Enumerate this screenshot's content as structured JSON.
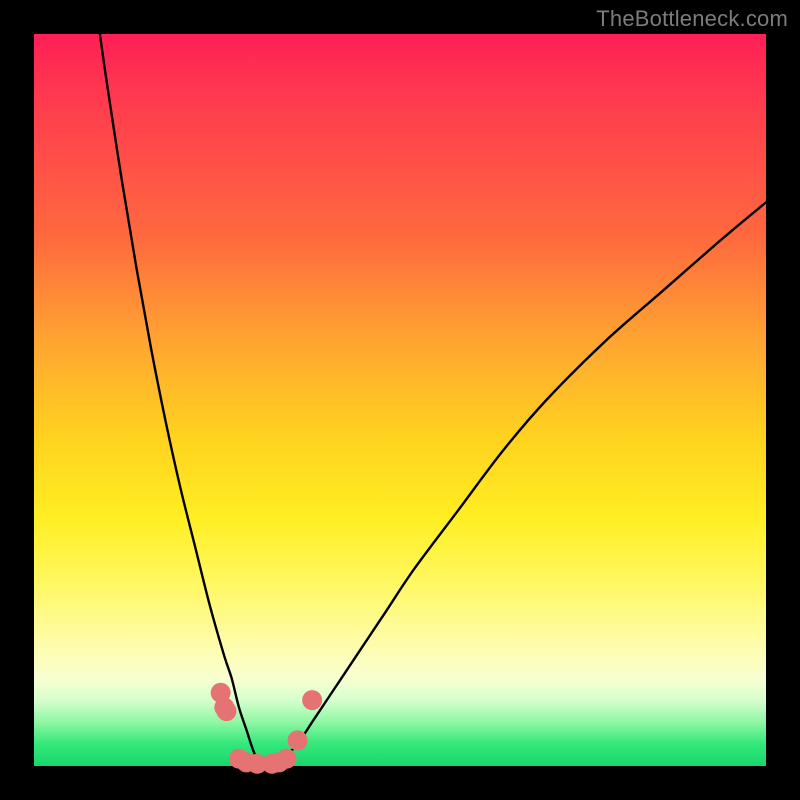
{
  "watermark": "TheBottleneck.com",
  "chart_data": {
    "type": "line",
    "title": "",
    "xlabel": "",
    "ylabel": "",
    "xlim": [
      0,
      100
    ],
    "ylim": [
      0,
      100
    ],
    "grid": false,
    "series": [
      {
        "name": "bottleneck-curve",
        "x": [
          9,
          10,
          12,
          14,
          16,
          18,
          20,
          22,
          24,
          26,
          27,
          28,
          29,
          30,
          31,
          32,
          33,
          34,
          36,
          38,
          40,
          44,
          48,
          52,
          58,
          64,
          70,
          78,
          86,
          94,
          100
        ],
        "values": [
          100,
          93,
          80,
          68,
          57,
          47,
          38,
          30,
          22,
          15,
          12,
          8,
          5,
          2,
          0,
          0,
          0,
          1,
          3,
          6,
          9,
          15,
          21,
          27,
          35,
          43,
          50,
          58,
          65,
          72,
          77
        ]
      }
    ],
    "markers": {
      "name": "highlight-dots",
      "color": "#e57373",
      "points": [
        {
          "x": 25.5,
          "y": 10
        },
        {
          "x": 26.0,
          "y": 8
        },
        {
          "x": 26.3,
          "y": 7.5
        },
        {
          "x": 28.0,
          "y": 1
        },
        {
          "x": 29.0,
          "y": 0.5
        },
        {
          "x": 30.5,
          "y": 0.3
        },
        {
          "x": 32.5,
          "y": 0.3
        },
        {
          "x": 33.5,
          "y": 0.5
        },
        {
          "x": 34.5,
          "y": 1
        },
        {
          "x": 36.0,
          "y": 3.5
        },
        {
          "x": 38.0,
          "y": 9
        }
      ]
    }
  }
}
